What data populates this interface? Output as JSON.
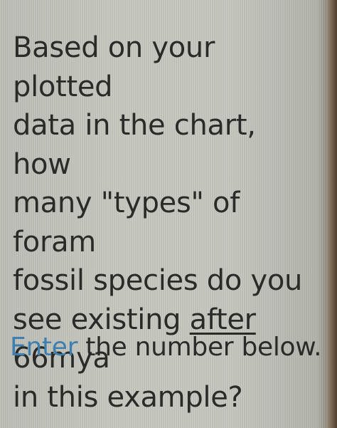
{
  "question": {
    "line1": "Based on your plotted",
    "line2": "data in the chart, how",
    "line3": "many \"types\" of foram",
    "line4": "fossil species do you",
    "line5_before": "see existing ",
    "line5_underlined": "after",
    "line5_after": " 66mya",
    "line6": "in this example?"
  },
  "instruction": {
    "enter_word": "Enter",
    "rest": " the number below."
  },
  "colors": {
    "text": "#2a2b28",
    "enter_accent": "#3f7fb0",
    "background": "#c9cbc3"
  }
}
